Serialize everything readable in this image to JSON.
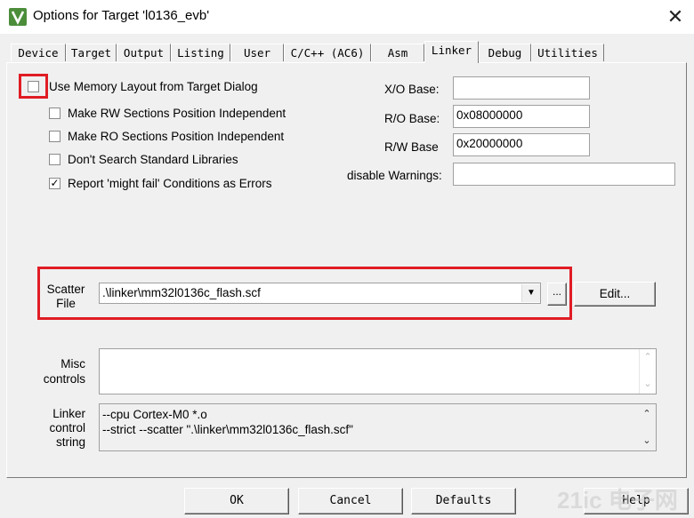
{
  "window": {
    "title": "Options for Target 'l0136_evb'",
    "close_symbol": "✕"
  },
  "tabs": [
    "Device",
    "Target",
    "Output",
    "Listing",
    "User",
    "C/C++ (AC6)",
    "Asm",
    "Linker",
    "Debug",
    "Utilities"
  ],
  "active_tab": "Linker",
  "options": {
    "use_memory_layout": {
      "label": "Use Memory Layout from Target Dialog",
      "checked": false
    },
    "rw_independent": {
      "label": "Make RW Sections Position Independent",
      "checked": false
    },
    "ro_independent": {
      "label": "Make RO Sections Position Independent",
      "checked": false
    },
    "dont_search_libs": {
      "label": "Don't Search Standard Libraries",
      "checked": false
    },
    "report_might_fail": {
      "label": "Report 'might fail' Conditions as Errors",
      "checked": true
    }
  },
  "addresses": {
    "xo_label": "X/O Base:",
    "xo_value": "",
    "ro_label": "R/O Base:",
    "ro_value": "0x08000000",
    "rw_label": "R/W Base",
    "rw_value": "0x20000000",
    "warnings_label": "disable Warnings:",
    "warnings_value": ""
  },
  "scatter": {
    "label_line1": "Scatter",
    "label_line2": "File",
    "value": ".\\linker\\mm32l0136c_flash.scf",
    "browse_label": "...",
    "edit_label": "Edit..."
  },
  "misc": {
    "label_line1": "Misc",
    "label_line2": "controls",
    "value": ""
  },
  "linker_control": {
    "label_line1": "Linker",
    "label_line2": "control",
    "label_line3": "string",
    "line1": "--cpu Cortex-M0 *.o",
    "line2": "--strict --scatter \".\\linker\\mm32l0136c_flash.scf\""
  },
  "buttons": {
    "ok": "OK",
    "cancel": "Cancel",
    "defaults": "Defaults",
    "help": "Help"
  },
  "watermark": "21ic 电子网",
  "colors": {
    "highlight": "#e01c24",
    "dialog_bg": "#f0f0f0",
    "app_icon": "#4c8d3a"
  }
}
